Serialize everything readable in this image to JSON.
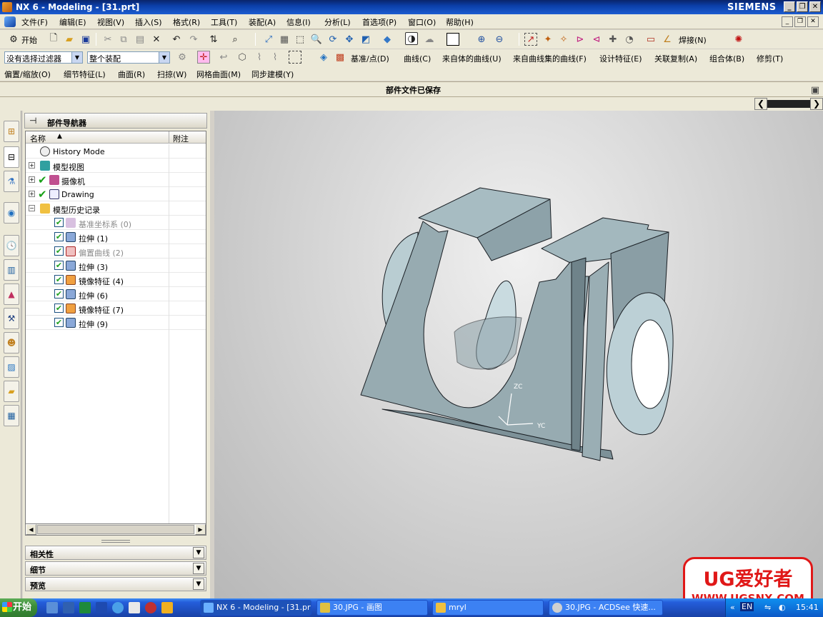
{
  "window": {
    "title": "NX 6 - Modeling - [31.prt]",
    "brand": "SIEMENS"
  },
  "menubar": {
    "items": [
      "文件(F)",
      "编辑(E)",
      "视图(V)",
      "插入(S)",
      "格式(R)",
      "工具(T)",
      "装配(A)",
      "信息(I)",
      "分析(L)",
      "首选项(P)",
      "窗口(O)",
      "帮助(H)"
    ]
  },
  "toolbar1": {
    "start_label": "开始"
  },
  "toolbar2": {
    "filter_value": "没有选择过滤器",
    "scope_value": "整个装配",
    "menus": [
      "基准/点(D)",
      "曲线(C)",
      "来自体的曲线(U)",
      "来自曲线集的曲线(F)",
      "设计特征(E)",
      "关联复制(A)",
      "组合体(B)",
      "修剪(T)"
    ]
  },
  "toolbar3": {
    "menus": [
      "偏置/缩放(O)",
      "细节特征(L)",
      "曲面(R)",
      "扫掠(W)",
      "网格曲面(M)",
      "同步建模(Y)"
    ]
  },
  "toolbar1_extra": {
    "weld_label": "焊接(N)"
  },
  "status": {
    "message": "部件文件已保存"
  },
  "navigator": {
    "title": "部件导航器",
    "col_name": "名称",
    "col_note": "附注",
    "nodes": [
      {
        "label": "History Mode"
      },
      {
        "label": "模型视图"
      },
      {
        "label": "摄像机"
      },
      {
        "label": "Drawing"
      },
      {
        "label": "模型历史记录"
      },
      {
        "label": "基准坐标系 (0)"
      },
      {
        "label": "拉伸 (1)"
      },
      {
        "label": "偏置曲线 (2)"
      },
      {
        "label": "拉伸 (3)"
      },
      {
        "label": "镜像特征 (4)"
      },
      {
        "label": "拉伸 (6)"
      },
      {
        "label": "镜像特征 (7)"
      },
      {
        "label": "拉伸 (9)"
      }
    ],
    "sections": [
      "相关性",
      "细节",
      "预览"
    ]
  },
  "viewport": {
    "axis_z": "ZC",
    "axis_y": "YC"
  },
  "taskbar": {
    "start": "开始",
    "tasks": [
      "NX 6 - Modeling - [31.prt]",
      "30.JPG - 画图",
      "mryl",
      "30.JPG - ACDSee 快速..."
    ],
    "tray_lang": "EN",
    "clock": "15:41"
  },
  "watermark": {
    "line1": "UG爱好者",
    "line2": "WWW.UGSNX.COM"
  }
}
